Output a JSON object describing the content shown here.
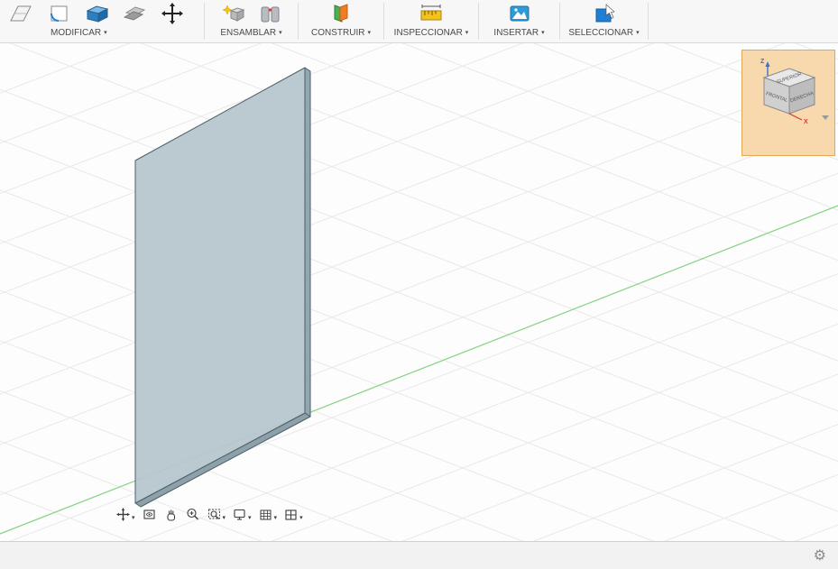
{
  "toolbar": {
    "caret": "▾",
    "groups": [
      {
        "label": "MODIFICAR"
      },
      {
        "label": "ENSAMBLAR"
      },
      {
        "label": "CONSTRUIR"
      },
      {
        "label": "INSPECCIONAR"
      },
      {
        "label": "INSERTAR"
      },
      {
        "label": "SELECCIONAR"
      }
    ]
  },
  "viewcube": {
    "top_face": "SUPERIOR",
    "front_face": "FRONTAL",
    "right_face": "DERECHA",
    "z_axis": "Z",
    "x_axis": "X"
  },
  "navbar": {
    "caret": "▾",
    "items": [
      {
        "name": "orbit"
      },
      {
        "name": "look-at"
      },
      {
        "name": "pan"
      },
      {
        "name": "zoom"
      },
      {
        "name": "fit"
      },
      {
        "name": "display-settings"
      },
      {
        "name": "grid-and-snaps"
      },
      {
        "name": "viewports"
      }
    ]
  },
  "statusbar": {
    "gear_glyph": "⚙"
  },
  "colors": {
    "viewcube_highlight": "#f7d9ad",
    "viewcube_border": "#e2a757",
    "panel_face": "#b7c6cd",
    "panel_edge": "#4f6068",
    "axis_green": "#8bd48b",
    "axis_z_blue": "#3b6fd4",
    "axis_x_red": "#d43b3b",
    "accent_blue": "#1f7fd4"
  }
}
